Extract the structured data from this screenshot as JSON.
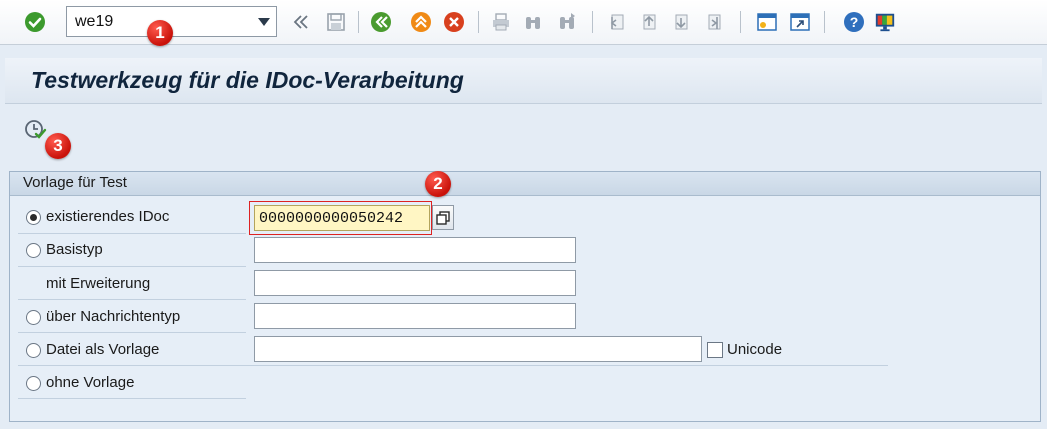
{
  "toolbar": {
    "command_field_value": "we19",
    "icons": [
      "enter-icon",
      "command-dropdown-icon",
      "collapse-icon",
      "save-icon",
      "back-icon",
      "exit-icon",
      "cancel-icon",
      "print-icon",
      "find-icon",
      "find-next-icon",
      "first-page-icon",
      "previous-page-icon",
      "next-page-icon",
      "last-page-icon",
      "create-session-icon",
      "create-shortcut-icon",
      "help-icon",
      "customize-layout-icon"
    ]
  },
  "title": "Testwerkzeug für die IDoc-Verarbeitung",
  "app_toolbar": {
    "execute_icon": "execute-icon"
  },
  "callouts": {
    "one": "1",
    "two": "2",
    "three": "3"
  },
  "group": {
    "title": "Vorlage für Test",
    "options": {
      "existing_idoc": {
        "label": "existierendes IDoc",
        "value": "0000000000050242",
        "selected": true
      },
      "basistyp": {
        "label": "Basistyp",
        "value": ""
      },
      "erweiterung": {
        "label": "mit Erweiterung",
        "value": ""
      },
      "nachrichtentyp": {
        "label": "über Nachrichtentyp",
        "value": ""
      },
      "datei": {
        "label": "Datei als Vorlage",
        "value": ""
      },
      "unicode": {
        "label": "Unicode",
        "checked": false
      },
      "ohne": {
        "label": "ohne Vorlage"
      }
    }
  },
  "colors": {
    "badge_red": "#d0140c",
    "active_field": "#fff6c4",
    "title_text": "#10253d"
  }
}
